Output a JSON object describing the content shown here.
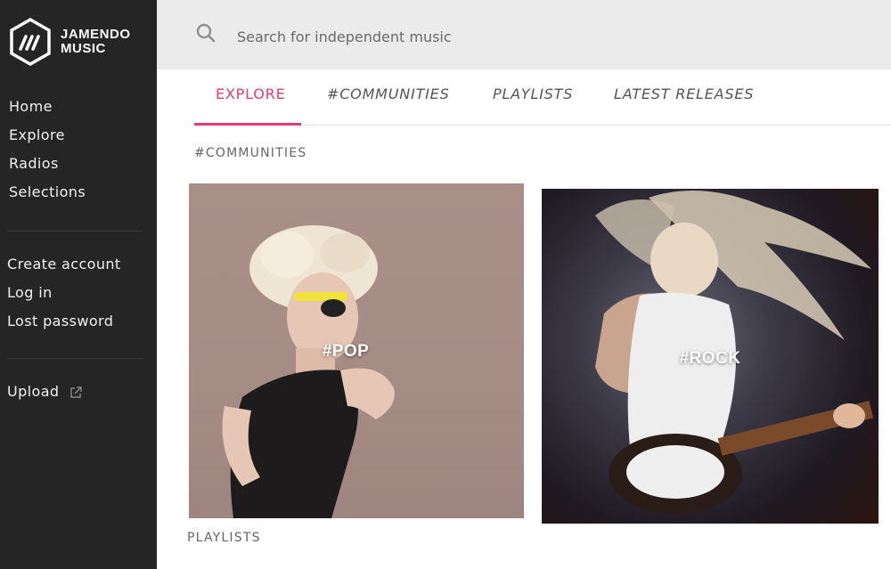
{
  "brand": {
    "line1": "JAMENDO",
    "line2": "MUSIC"
  },
  "sidebar": {
    "main": [
      "Home",
      "Explore",
      "Radios",
      "Selections"
    ],
    "account": [
      "Create account",
      "Log in",
      "Lost password"
    ],
    "upload": "Upload"
  },
  "search": {
    "placeholder": "Search for independent music"
  },
  "tabs": [
    "EXPLORE",
    "#COMMUNITIES",
    "PLAYLISTS",
    "LATEST RELEASES"
  ],
  "active_tab": "EXPLORE",
  "sections": {
    "communities": "#COMMUNITIES",
    "playlists": "PLAYLISTS"
  },
  "communities": [
    {
      "label": "#POP",
      "icon": "pop-cover-image"
    },
    {
      "label": "#ROCK",
      "icon": "rock-cover-image"
    }
  ],
  "colors": {
    "accent": "#e83a6e",
    "sidebar": "#252525",
    "searchbar": "#ebebeb"
  }
}
